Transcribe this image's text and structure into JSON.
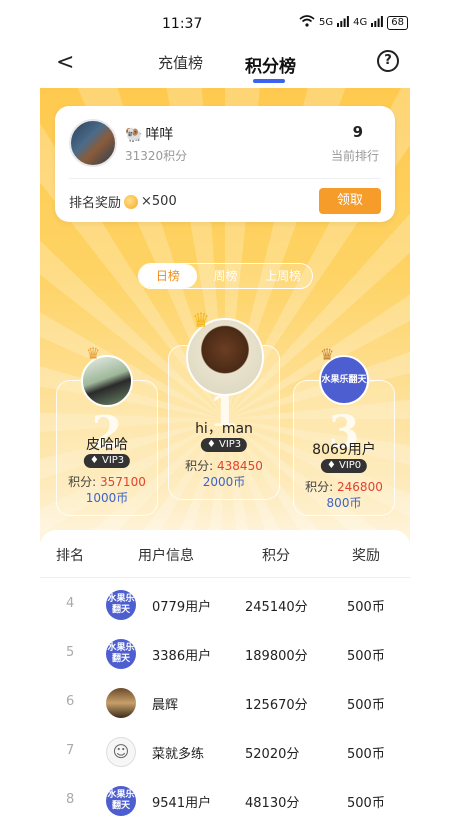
{
  "status": {
    "time": "11:37",
    "net1": "5G",
    "net2": "4G",
    "battery": "68"
  },
  "nav": {
    "back": "<",
    "tabs": [
      "充值榜",
      "积分榜"
    ],
    "active_tab": "积分榜",
    "help": "?"
  },
  "me": {
    "name": "咩咩",
    "points": "31320积分",
    "rank": "9",
    "rank_label": "当前排行",
    "reward_label": "排名奖励",
    "reward_value": "×500",
    "claim": "领取"
  },
  "periods": [
    "日榜",
    "周榜",
    "上周榜"
  ],
  "podium": [
    {
      "pos": "2",
      "name": "皮哈哈",
      "vip": "VIP3",
      "points_label": "积分:",
      "points": "357100",
      "coins": "1000币"
    },
    {
      "pos": "1",
      "name": "hi，man",
      "vip": "VIP3",
      "points_label": "积分:",
      "points": "438450",
      "coins": "2000币"
    },
    {
      "pos": "3",
      "name": "8069用户",
      "vip": "VIP0",
      "points_label": "积分:",
      "points": "246800",
      "coins": "800币",
      "avatar_text": "水果乐翻天"
    }
  ],
  "table": {
    "headers": [
      "排名",
      "用户信息",
      "积分",
      "奖励"
    ],
    "rows": [
      {
        "rank": "4",
        "name": "0779用户",
        "points": "245140分",
        "reward": "500币",
        "avatar": "水果乐翻天"
      },
      {
        "rank": "5",
        "name": "3386用户",
        "points": "189800分",
        "reward": "500币",
        "avatar": "水果乐翻天"
      },
      {
        "rank": "6",
        "name": "晨辉",
        "points": "125670分",
        "reward": "500币",
        "avatar": ""
      },
      {
        "rank": "7",
        "name": "菜就多练",
        "points": "52020分",
        "reward": "500币",
        "avatar": ""
      },
      {
        "rank": "8",
        "name": "9541用户",
        "points": "48130分",
        "reward": "500币",
        "avatar": "水果乐翻天"
      }
    ]
  }
}
